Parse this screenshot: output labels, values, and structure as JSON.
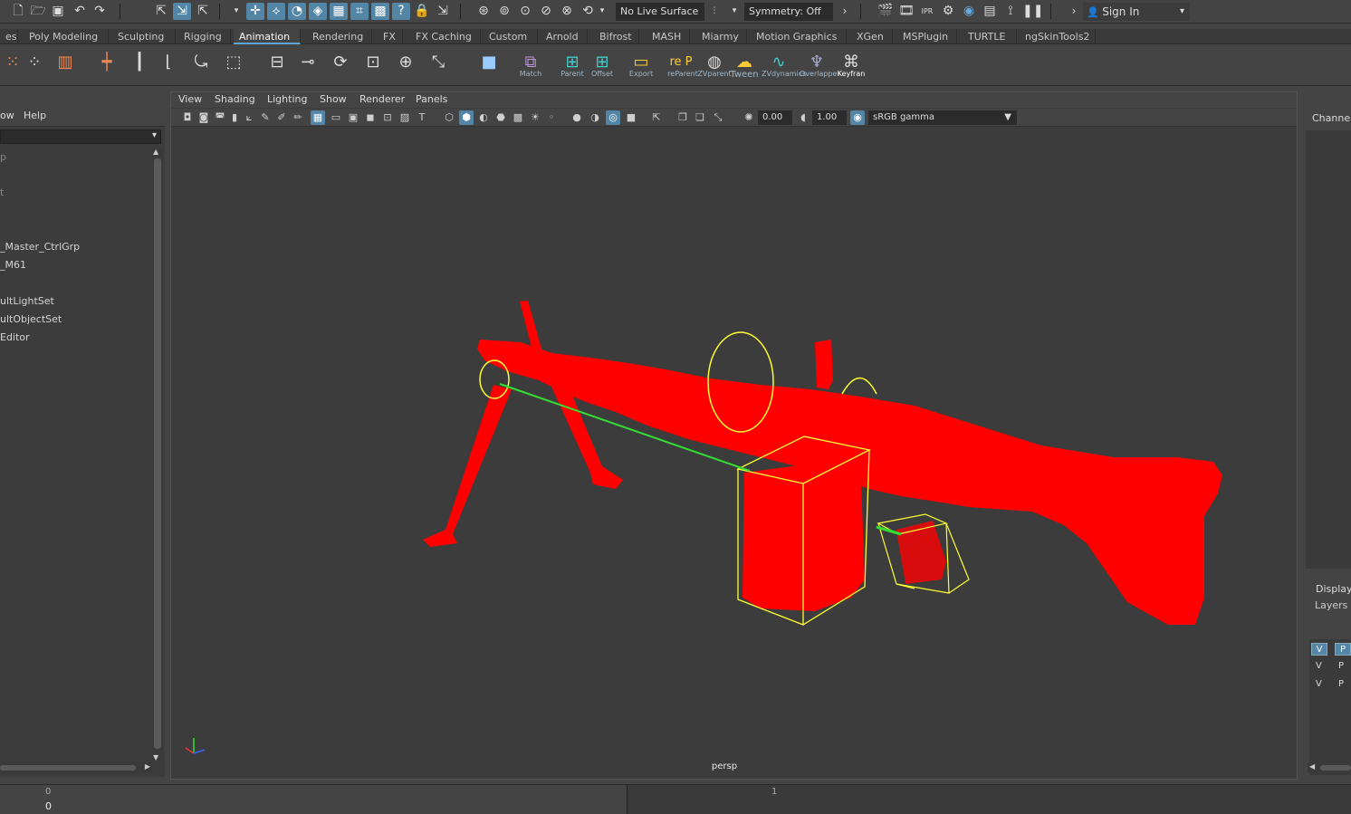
{
  "statusline": {
    "live_surface": "No Live Surface",
    "symmetry": "Symmetry: Off",
    "sign_in": "Sign In",
    "icons": [
      "new-scene-icon",
      "open-scene-icon",
      "save-scene-icon",
      "undo-icon",
      "redo-icon",
      "select-by-hierarchy-icon",
      "select-by-object-icon",
      "select-by-component-icon",
      "snap-grid-icon",
      "snap-curve-icon",
      "snap-point-icon",
      "snap-view-icon",
      "snap-surface-icon",
      "lock-icon",
      "history-icon",
      "render-icon",
      "ipr-icon",
      "render-settings-icon",
      "hypershade-icon"
    ]
  },
  "shelf_tabs": [
    "es",
    "Poly Modeling",
    "Sculpting",
    "Rigging",
    "Animation",
    "Rendering",
    "FX",
    "FX Caching",
    "Custom",
    "Arnold",
    "Bifrost",
    "MASH",
    "Miarmy",
    "Motion Graphics",
    "XGen",
    "MSPlugin",
    "TURTLE",
    "ngSkinTools2"
  ],
  "active_shelf_tab": "Animation",
  "shelf_labels": {
    "match": "Match",
    "parent": "Parent",
    "offset": "Offset",
    "export": "Export",
    "reparent": "reParent",
    "zvparent": "ZVparent",
    "tween": "Tween",
    "zvdynamics": "ZVdynamics",
    "overlapper": "Overlapper",
    "keyframe": "Keyfran"
  },
  "outliner": {
    "menu": [
      "ow",
      "Help"
    ],
    "items": [
      "p",
      "t",
      "_Master_CtrlGrp",
      "_M61",
      "ultLightSet",
      "ultObjectSet",
      "Editor"
    ]
  },
  "viewport": {
    "menus": [
      "View",
      "Shading",
      "Lighting",
      "Show",
      "Renderer",
      "Panels"
    ],
    "exposure": "0.00",
    "gamma": "1.00",
    "colorspace": "sRGB gamma",
    "camera_label": "persp"
  },
  "channel_box": {
    "title": "Channel",
    "display": "Display",
    "layers": "Layers",
    "layer_rows": [
      [
        "V",
        "P"
      ],
      [
        "V",
        "P"
      ],
      [
        "V",
        "P"
      ]
    ]
  },
  "timeline": {
    "start_top": "0",
    "start_bottom": "0",
    "marker": "1"
  },
  "colors": {
    "selected": "#ff0000",
    "active_accent": "#5285a6",
    "wire_yellow": "#ffff33",
    "wire_green": "#33dd33"
  }
}
